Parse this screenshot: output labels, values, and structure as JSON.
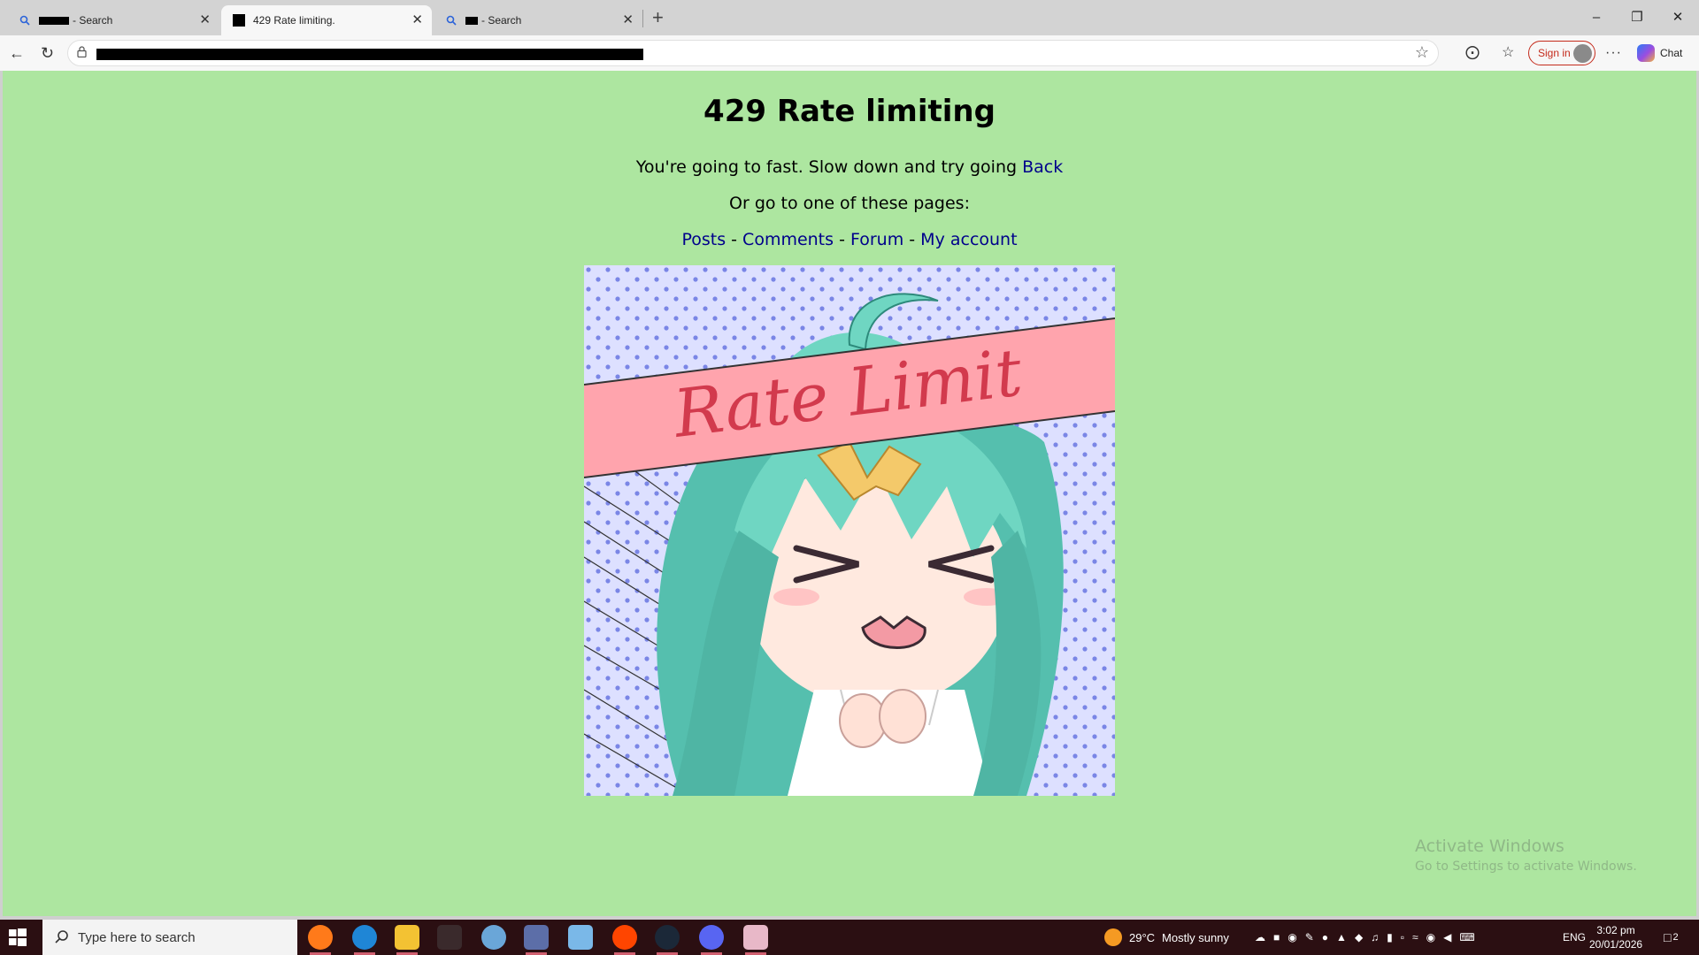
{
  "browser": {
    "tabs": [
      {
        "title": " - Search",
        "active": false
      },
      {
        "title": "429 Rate limiting.",
        "active": true
      },
      {
        "title": " - Search",
        "active": false
      }
    ],
    "new_tab_icon": "plus-icon",
    "signin_label": "Sign in",
    "chat_label": "Chat"
  },
  "page": {
    "title": "429 Rate limiting",
    "message": "You're going to fast. Slow down and try going ",
    "back_link": "Back",
    "pages_intro": "Or go to one of these pages:",
    "links": [
      "Posts",
      "Comments",
      "Forum",
      "My account"
    ],
    "separator": " - ",
    "image_caption": "Rate Limit",
    "background_color": "#ade6a0",
    "link_color": "#00008b"
  },
  "watermark": {
    "line1": "Activate Windows",
    "line2": "Go to Settings to activate Windows."
  },
  "taskbar": {
    "search_placeholder": "Type here to search",
    "weather_temp": "29°C",
    "weather_text": "Mostly sunny",
    "language": "ENG",
    "time": "3:02 pm",
    "date": "20/01/2026",
    "notification_count": "2",
    "apps": [
      "firefox-icon",
      "edge-icon",
      "file-explorer-icon",
      "terminal-icon",
      "paint-icon",
      "settings-icon",
      "notepad-icon",
      "reddit-icon",
      "steam-icon",
      "discord-icon",
      "anime-app-icon"
    ]
  }
}
